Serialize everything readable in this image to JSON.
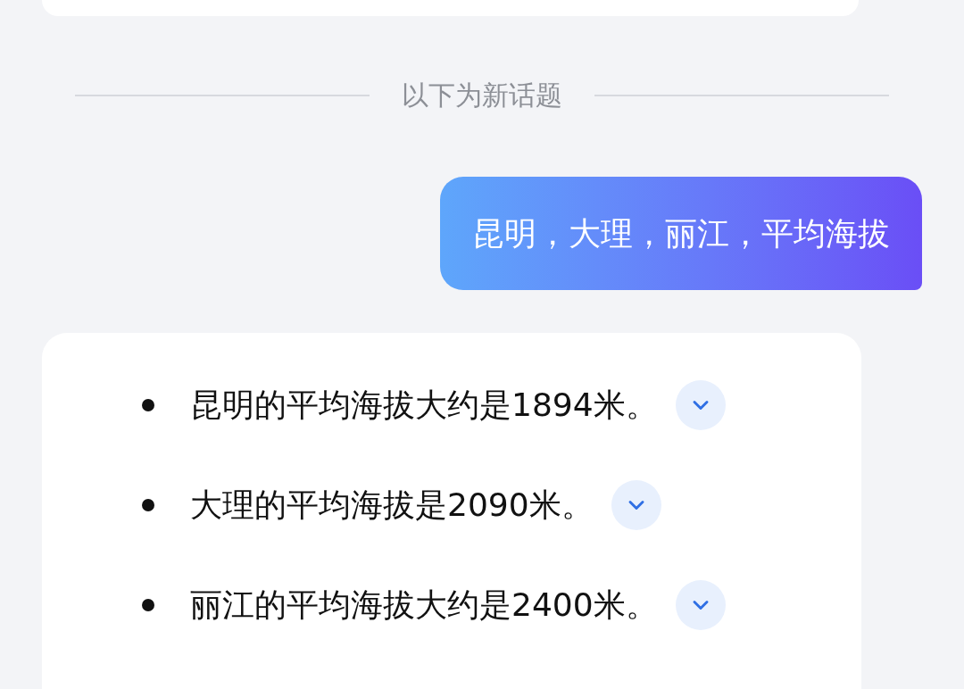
{
  "divider": {
    "label": "以下为新话题"
  },
  "user_message": {
    "text": "昆明，大理，丽江，平均海拔"
  },
  "answer": {
    "items": [
      {
        "text": "昆明的平均海拔大约是1894米。",
        "expanded": false
      },
      {
        "text": "大理的平均海拔是2090米。",
        "expanded": false
      },
      {
        "text": "丽江的平均海拔大约是2400米。",
        "expanded": false
      }
    ]
  }
}
